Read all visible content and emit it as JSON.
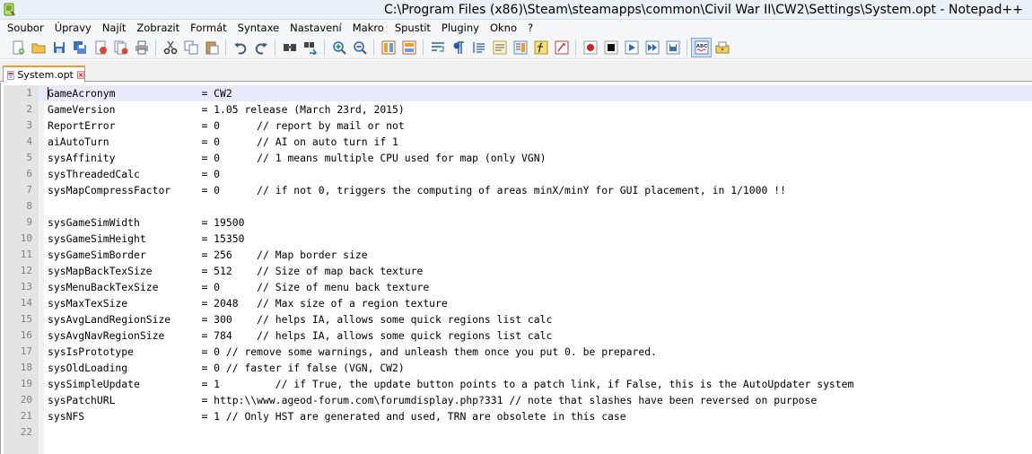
{
  "window": {
    "title": "C:\\Program Files (x86)\\Steam\\steamapps\\common\\Civil War II\\CW2\\Settings\\System.opt - Notepad++"
  },
  "menu": [
    "Soubor",
    "Úpravy",
    "Najít",
    "Zobrazit",
    "Formát",
    "Syntaxe",
    "Nastavení",
    "Makro",
    "Spustit",
    "Pluginy",
    "Okno",
    "?"
  ],
  "toolbar": {
    "groups": [
      [
        "new-file-icon",
        "open-file-icon",
        "save-icon",
        "save-all-icon",
        "close-icon",
        "close-all-icon",
        "print-icon"
      ],
      [
        "cut-icon",
        "copy-icon",
        "paste-icon"
      ],
      [
        "undo-icon",
        "redo-icon"
      ],
      [
        "find-icon",
        "replace-icon"
      ],
      [
        "zoom-in-icon",
        "zoom-out-icon"
      ],
      [
        "sync-vertical-icon",
        "sync-horizontal-icon"
      ],
      [
        "word-wrap-icon",
        "show-all-characters-icon",
        "indent-guide-icon",
        "user-language-icon",
        "doc-map-icon",
        "function-list-icon",
        "folder-workspace-icon"
      ],
      [
        "record-macro-icon",
        "stop-macro-icon",
        "play-macro-icon",
        "run-macro-multiple-icon",
        "save-macro-icon"
      ],
      [
        "spell-check-icon",
        "plugin-icon"
      ]
    ],
    "active_icon": "spell-check-icon"
  },
  "tabs": [
    {
      "label": "System.opt",
      "state": "unsaved-modified"
    }
  ],
  "editor": {
    "current_line": 1,
    "lines": [
      {
        "n": "1",
        "text": "GameAcronym              = CW2"
      },
      {
        "n": "2",
        "text": "GameVersion              = 1.05 release (March 23rd, 2015)"
      },
      {
        "n": "3",
        "text": "ReportError              = 0      // report by mail or not"
      },
      {
        "n": "4",
        "text": "aiAutoTurn               = 0      // AI on auto turn if 1"
      },
      {
        "n": "5",
        "text": "sysAffinity              = 0      // 1 means multiple CPU used for map (only VGN)"
      },
      {
        "n": "6",
        "text": "sysThreadedCalc          = 0"
      },
      {
        "n": "7",
        "text": "sysMapCompressFactor     = 0      // if not 0, triggers the computing of areas minX/minY for GUI placement, in 1/1000 !!"
      },
      {
        "n": "8",
        "text": ""
      },
      {
        "n": "9",
        "text": "sysGameSimWidth          = 19500"
      },
      {
        "n": "10",
        "text": "sysGameSimHeight         = 15350"
      },
      {
        "n": "11",
        "text": "sysGameSimBorder         = 256    // Map border size"
      },
      {
        "n": "12",
        "text": "sysMapBackTexSize        = 512    // Size of map back texture"
      },
      {
        "n": "13",
        "text": "sysMenuBackTexSize       = 0      // Size of menu back texture"
      },
      {
        "n": "14",
        "text": "sysMaxTexSize            = 2048   // Max size of a region texture"
      },
      {
        "n": "15",
        "text": "sysAvgLandRegionSize     = 300    // helps IA, allows some quick regions list calc"
      },
      {
        "n": "16",
        "text": "sysAvgNavRegionSize      = 784    // helps IA, allows some quick regions list calc"
      },
      {
        "n": "17",
        "text": "sysIsPrototype           = 0 // remove some warnings, and unleash them once you put 0. be prepared."
      },
      {
        "n": "18",
        "text": "sysOldLoading            = 0 // faster if false (VGN, CW2)"
      },
      {
        "n": "19",
        "text": "sysSimpleUpdate          = 1         // if True, the update button points to a patch link, if False, this is the AutoUpdater system"
      },
      {
        "n": "20",
        "text": "sysPatchURL              = http:\\\\www.ageod-forum.com\\forumdisplay.php?331 // note that slashes have been reversed on purpose"
      },
      {
        "n": "21",
        "text": "sysNFS                   = 1 // Only HST are generated and used, TRN are obsolete in this case"
      },
      {
        "n": "22",
        "text": ""
      }
    ]
  }
}
